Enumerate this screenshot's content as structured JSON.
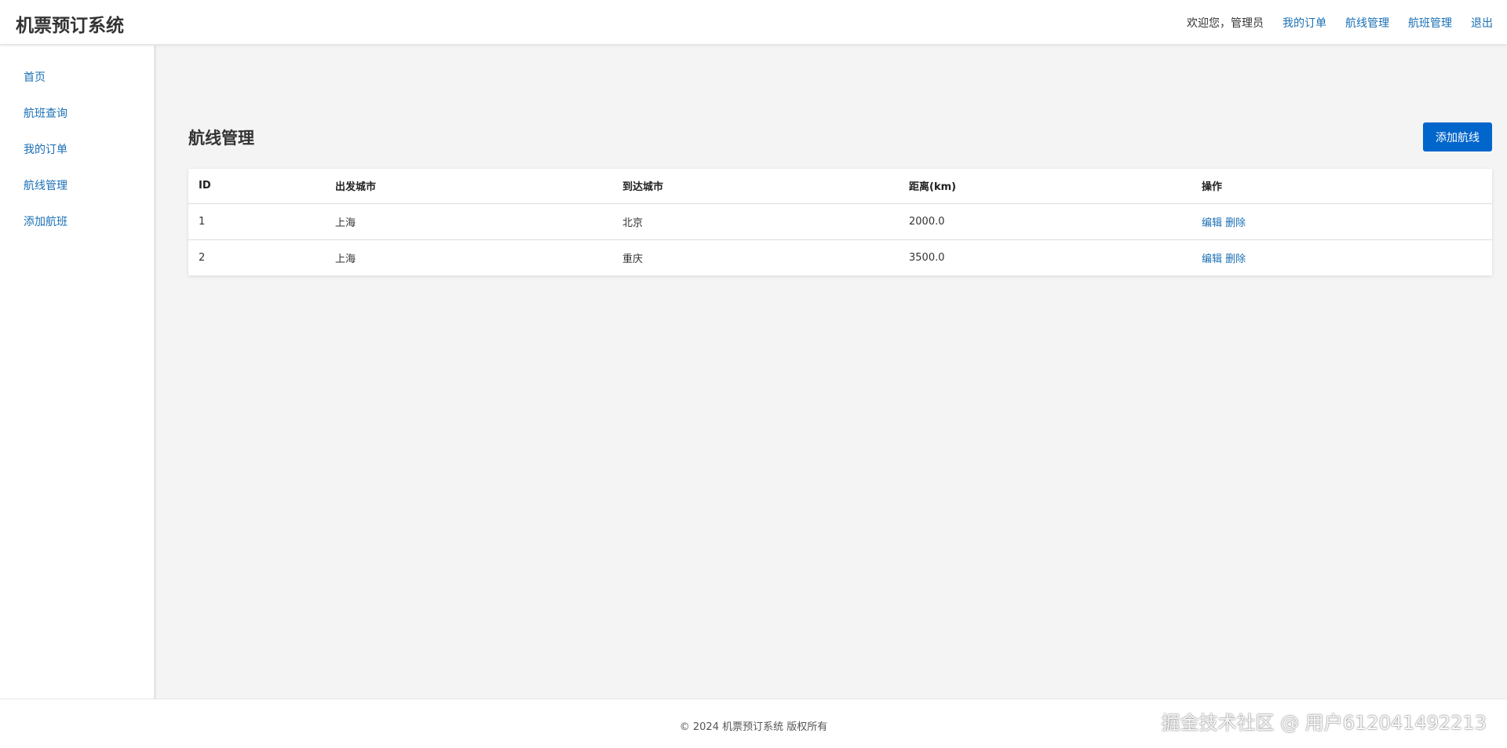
{
  "header": {
    "logo": "机票预订系统",
    "welcome": "欢迎您，管理员",
    "nav": [
      "我的订单",
      "航线管理",
      "航班管理",
      "退出"
    ]
  },
  "sidebar": {
    "items": [
      "首页",
      "航班查询",
      "我的订单",
      "航线管理",
      "添加航班"
    ]
  },
  "main": {
    "title": "航线管理",
    "add_button": "添加航线",
    "table": {
      "headers": [
        "ID",
        "出发城市",
        "到达城市",
        "距离(km)",
        "操作"
      ],
      "rows": [
        {
          "id": "1",
          "from": "上海",
          "to": "北京",
          "distance": "2000.0",
          "edit": "编辑",
          "delete": "删除"
        },
        {
          "id": "2",
          "from": "上海",
          "to": "重庆",
          "distance": "3500.0",
          "edit": "编辑",
          "delete": "删除"
        }
      ]
    }
  },
  "footer": {
    "copyright": "© 2024 机票预订系统 版权所有",
    "watermark": "掘金技术社区 @ 用户612041492213"
  },
  "colors": {
    "primary": "#0066cc",
    "link": "#1a6fb5",
    "background": "#f4f4f4"
  }
}
